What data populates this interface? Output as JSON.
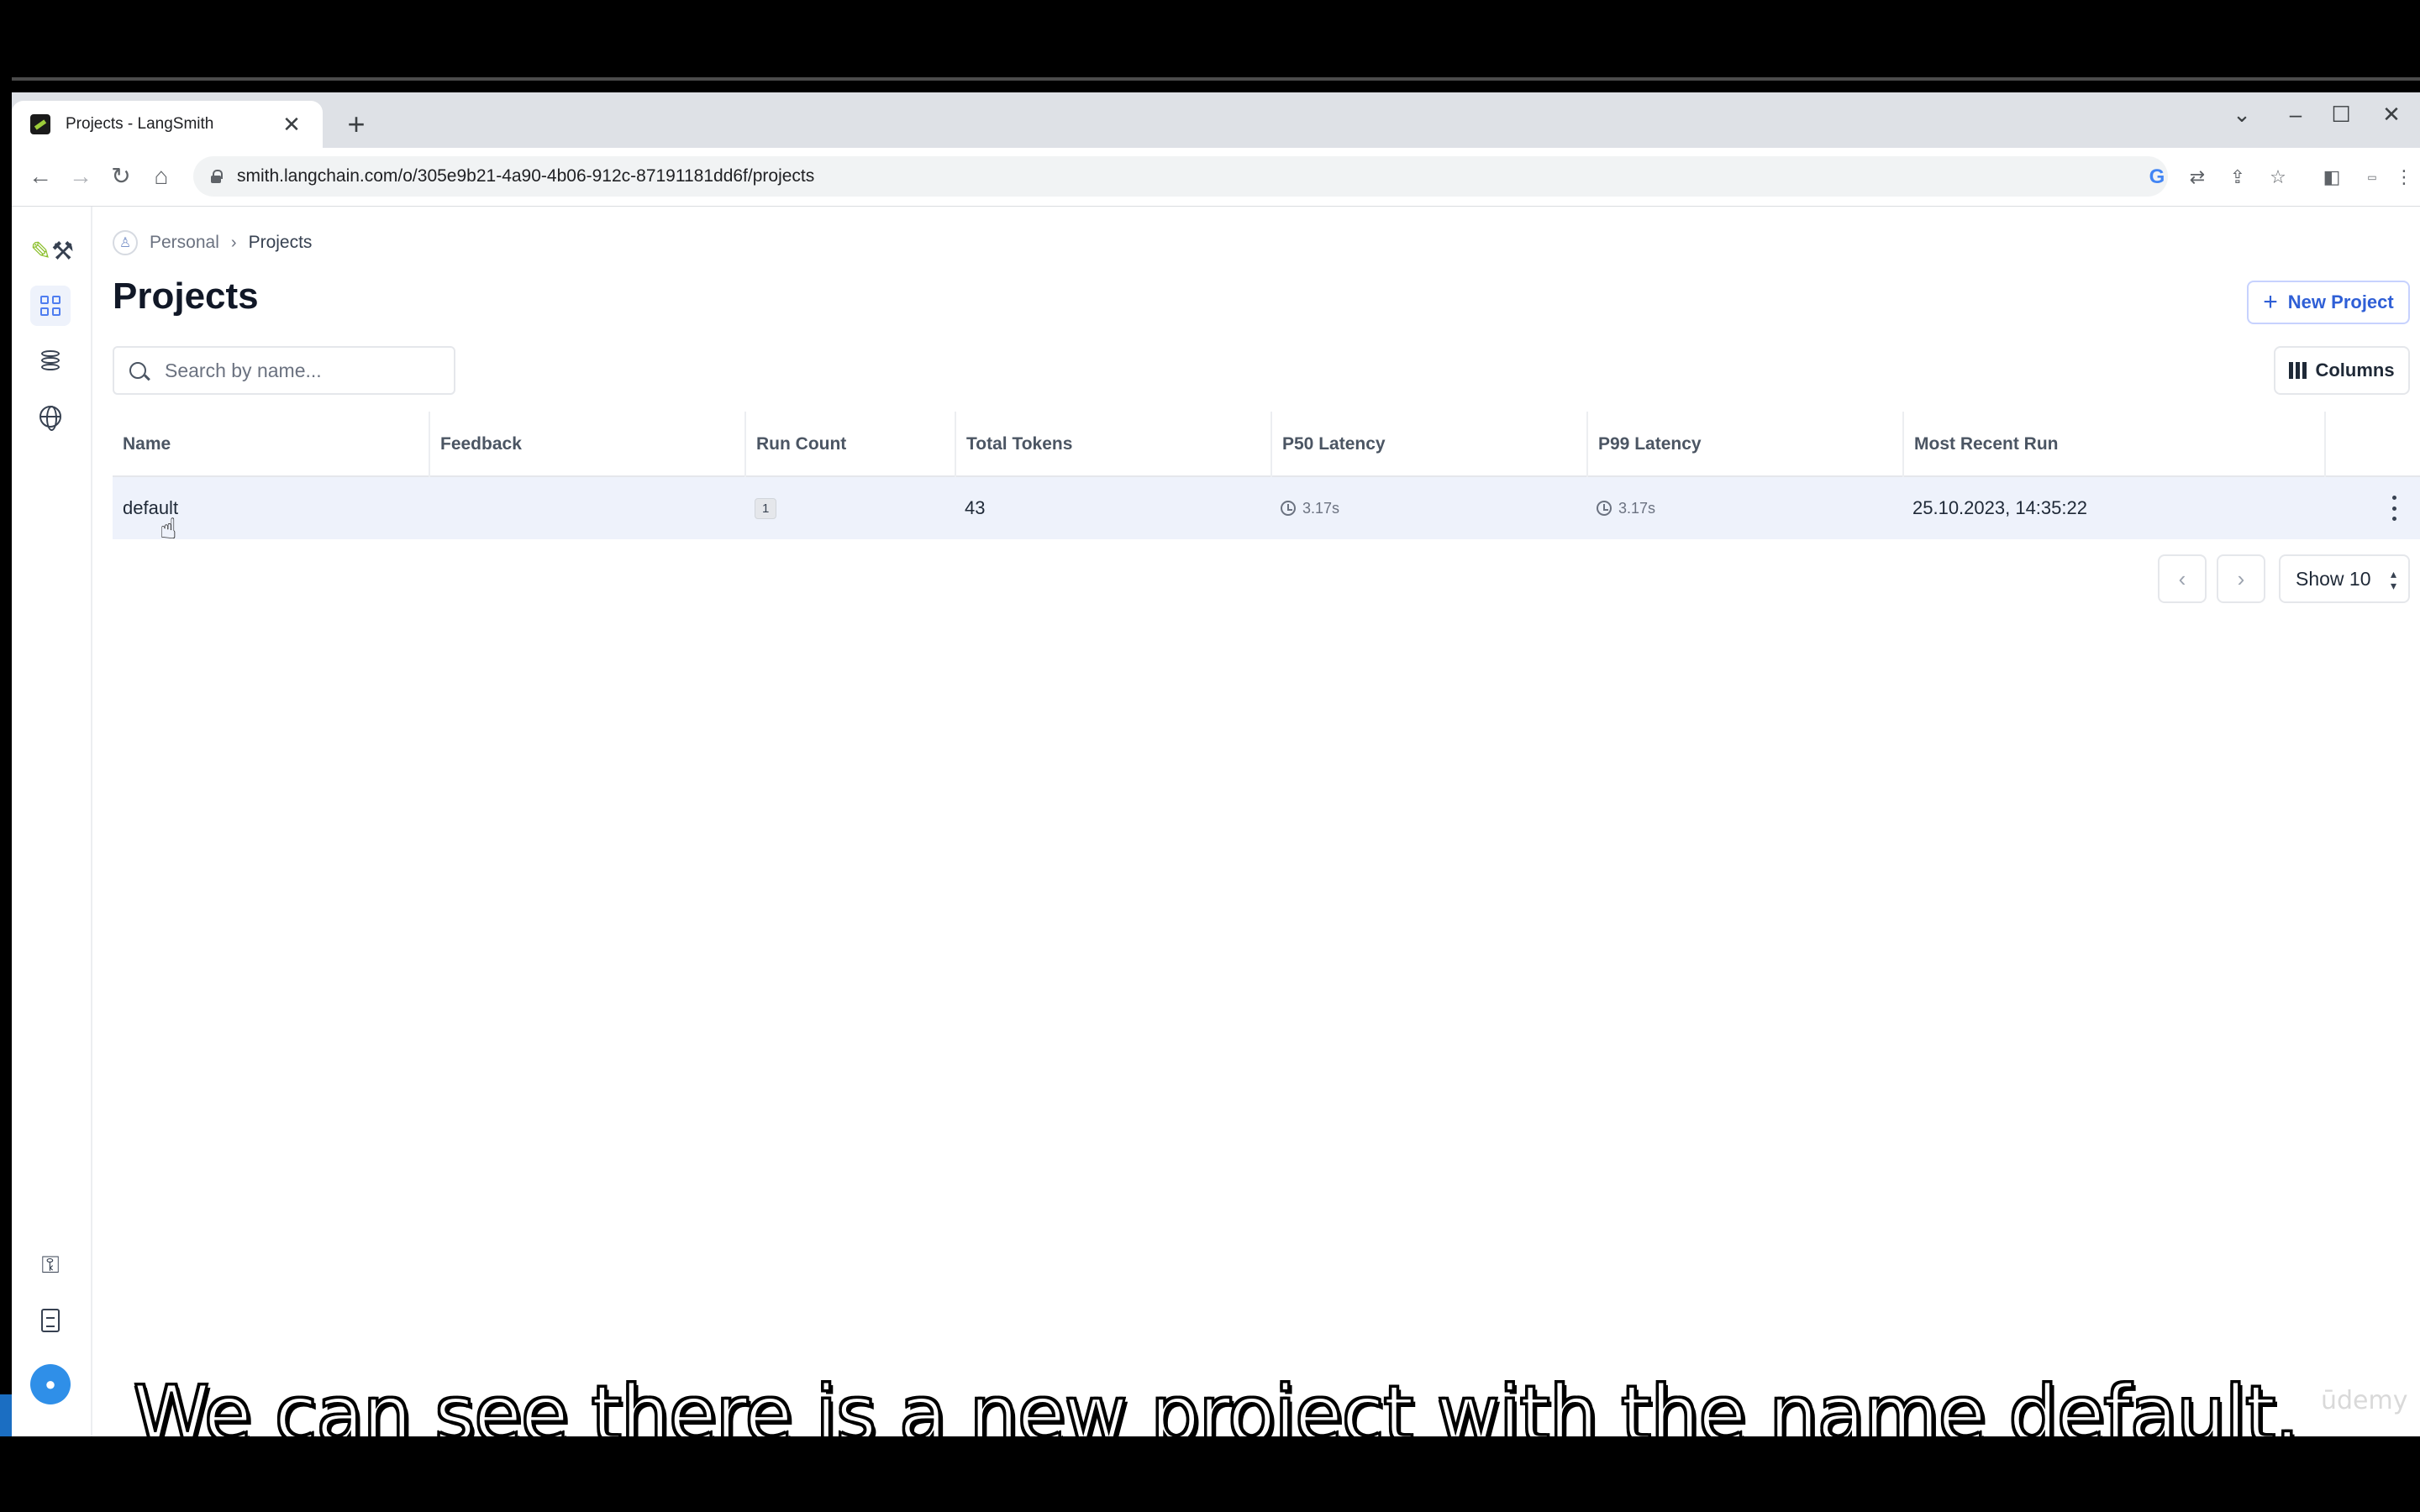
{
  "browser": {
    "tab_title": "Projects - LangSmith",
    "tab_close": "✕",
    "new_tab": "+",
    "url": "smith.langchain.com/o/305e9b21-4a90-4b06-912c-87191181dd6f/projects",
    "window_controls": [
      "⌄",
      "–",
      "☐",
      "✕"
    ]
  },
  "breadcrumb": {
    "parent": "Personal",
    "separator": "›",
    "current": "Projects"
  },
  "page": {
    "title": "Projects",
    "new_project_label": "New Project",
    "search_placeholder": "Search by name...",
    "columns_label": "Columns"
  },
  "table": {
    "headers": [
      "Name",
      "Feedback",
      "Run Count",
      "Total Tokens",
      "P50 Latency",
      "P99 Latency",
      "Most Recent Run"
    ],
    "rows": [
      {
        "name": "default",
        "feedback": "",
        "run_count": "1",
        "total_tokens": "43",
        "p50_latency": "3.17s",
        "p99_latency": "3.17s",
        "most_recent_run": "25.10.2023, 14:35:22"
      }
    ]
  },
  "pagination": {
    "prev": "‹",
    "next": "›",
    "show_label": "Show 10"
  },
  "caption": "We can see there is a new project with the name default.",
  "watermark": "ūdemy",
  "colors": {
    "accent": "#2f5fd6",
    "row_highlight": "#eef2fb",
    "avatar": "#2f8fe8"
  },
  "icons": [
    "search-icon",
    "columns-icon",
    "projects-grid-icon",
    "database-icon",
    "globe-icon",
    "key-icon",
    "document-icon",
    "person-icon",
    "clock-icon",
    "kebab-menu-icon"
  ]
}
